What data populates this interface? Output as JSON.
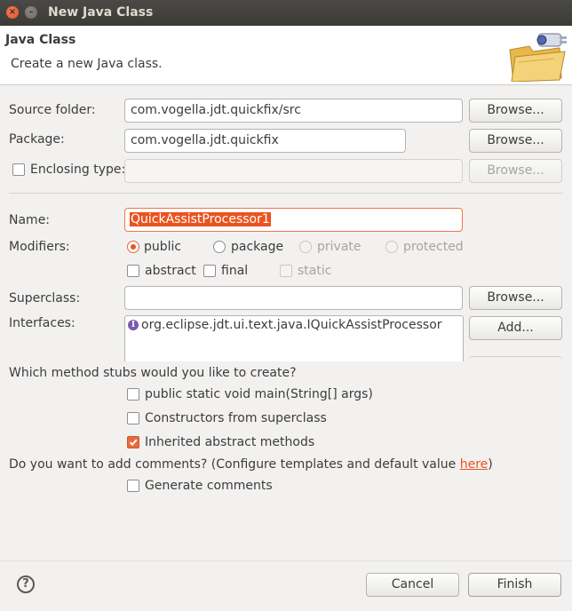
{
  "window": {
    "title": "New Java Class"
  },
  "header": {
    "title": "Java Class",
    "subtitle": "Create a new Java class."
  },
  "source_folder": {
    "label": "Source folder:",
    "value": "com.vogella.jdt.quickfix/src",
    "button": "Browse..."
  },
  "package": {
    "label": "Package:",
    "value": "com.vogella.jdt.quickfix",
    "button": "Browse..."
  },
  "enclosing": {
    "label": "Enclosing type:",
    "value": "",
    "button": "Browse...",
    "checked": false
  },
  "name": {
    "label": "Name:",
    "value": "QuickAssistProcessor1"
  },
  "modifiers": {
    "label": "Modifiers:",
    "access": [
      {
        "label": "public",
        "selected": true,
        "enabled": true
      },
      {
        "label": "package",
        "selected": false,
        "enabled": true
      },
      {
        "label": "private",
        "selected": false,
        "enabled": false
      },
      {
        "label": "protected",
        "selected": false,
        "enabled": false
      }
    ],
    "flags": [
      {
        "label": "abstract",
        "checked": false,
        "enabled": true
      },
      {
        "label": "final",
        "checked": false,
        "enabled": true
      },
      {
        "label": "static",
        "checked": false,
        "enabled": false
      }
    ]
  },
  "superclass": {
    "label": "Superclass:",
    "value": "",
    "button": "Browse..."
  },
  "interfaces": {
    "label": "Interfaces:",
    "items": [
      "org.eclipse.jdt.ui.text.java.IQuickAssistProcessor"
    ],
    "add_button": "Add..."
  },
  "stubs": {
    "question": "Which method stubs would you like to create?",
    "options": [
      {
        "label": "public static void main(String[] args)",
        "checked": false
      },
      {
        "label": "Constructors from superclass",
        "checked": false
      },
      {
        "label": "Inherited abstract methods",
        "checked": true
      }
    ]
  },
  "comments": {
    "question": "Do you want to add comments? (Configure templates and default value ",
    "link": "here",
    "question_end": ")",
    "option": {
      "label": "Generate comments",
      "checked": false
    }
  },
  "footer": {
    "cancel": "Cancel",
    "finish": "Finish"
  },
  "colors": {
    "accent": "#e95420",
    "titlebar": "#3c3b37",
    "background": "#f2f1f0"
  }
}
